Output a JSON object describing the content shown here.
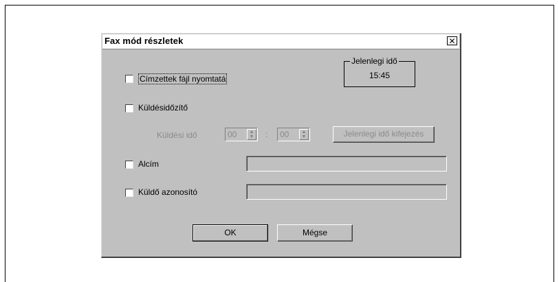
{
  "dialog": {
    "title": "Fax mód részletek",
    "close_symbol": "✕"
  },
  "options": {
    "print_recipients_label": "Címzettek fájl nyomtatá",
    "send_timer_label": "Küldésidőzítő",
    "send_time_label": "Küldési idő",
    "hour_value": "00",
    "minute_value": "00",
    "time_separator": ":",
    "current_time_button": "Jelenlegi idő kifejezés",
    "subtitle_label": "Alcím",
    "subtitle_value": "",
    "sender_id_label": "Küldő azonosító",
    "sender_id_value": ""
  },
  "current_time": {
    "label": "Jelenlegi idő",
    "value": "15:45"
  },
  "buttons": {
    "ok": "OK",
    "cancel": "Mégse"
  },
  "icons": {
    "close": "close-icon",
    "spin": "spin-arrows-icon"
  },
  "colors": {
    "dialog_bg": "#c0c0c0",
    "disabled_text": "#8a8a8a"
  }
}
